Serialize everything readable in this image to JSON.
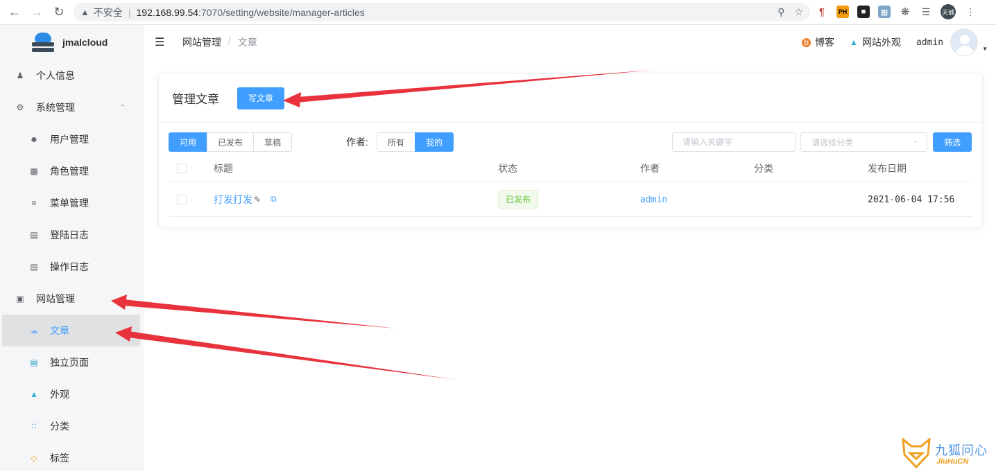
{
  "browser": {
    "insecure_label": "不安全",
    "url_host": "192.168.99.54",
    "url_path": ":7070/setting/website/manager-articles",
    "profile_label": "天诚"
  },
  "sidebar": {
    "brand": "jmalcloud",
    "items": [
      {
        "label": "个人信息",
        "icon": "user-icon"
      },
      {
        "label": "系统管理",
        "icon": "gear-icon"
      },
      {
        "label": "用户管理",
        "icon": "users-icon"
      },
      {
        "label": "角色管理",
        "icon": "id-card-icon"
      },
      {
        "label": "菜单管理",
        "icon": "sliders-icon"
      },
      {
        "label": "登陆日志",
        "icon": "login-log-icon"
      },
      {
        "label": "操作日志",
        "icon": "operation-log-icon"
      },
      {
        "label": "网站管理",
        "icon": "website-icon"
      },
      {
        "label": "文章",
        "icon": "article-icon"
      },
      {
        "label": "独立页面",
        "icon": "page-icon"
      },
      {
        "label": "外观",
        "icon": "shirt-icon"
      },
      {
        "label": "分类",
        "icon": "category-icon"
      },
      {
        "label": "标签",
        "icon": "tag-icon"
      }
    ]
  },
  "topbar": {
    "breadcrumb": [
      "网站管理",
      "文章"
    ],
    "blog_label": "博客",
    "appearance_label": "网站外观",
    "username": "admin"
  },
  "card": {
    "title": "管理文章",
    "write_button": "写文章",
    "status_filters": [
      "可用",
      "已发布",
      "草稿"
    ],
    "status_selected": "可用",
    "author_label": "作者:",
    "author_filters": [
      "所有",
      "我的"
    ],
    "author_selected": "我的",
    "keyword_placeholder": "请输入关键字",
    "category_placeholder": "请选择分类",
    "filter_button": "筛选"
  },
  "table": {
    "headers": [
      "标题",
      "状态",
      "作者",
      "分类",
      "发布日期"
    ],
    "rows": [
      {
        "title": "打发打发",
        "status": "已发布",
        "author": "admin",
        "category": "",
        "date": "2021-06-04 17:56"
      }
    ]
  },
  "watermark": {
    "text": "九狐问心",
    "sub": "JiuHuCN"
  },
  "colors": {
    "primary": "#409eff",
    "success": "#67c23a",
    "annotation_arrow": "#e8323c",
    "sidebar_bg": "#f5f6f7"
  }
}
